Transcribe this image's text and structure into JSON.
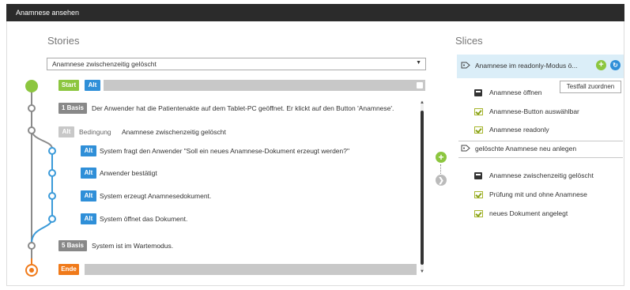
{
  "window": {
    "title": "Anamnese ansehen"
  },
  "stories": {
    "title": "Stories",
    "dropdown": {
      "selected": "Anamnese zwischenzeitig gelöscht"
    },
    "start": {
      "badge": "Start",
      "alt": "Alt"
    },
    "steps": [
      {
        "badge": "1 Basis",
        "text": "Der Anwender hat die Patientenakte auf dem Tablet-PC geöffnet. Er klickt auf den Button 'Anamnese'."
      },
      {
        "badge": "Alt",
        "label": "Bedingung",
        "text": "Anamnese zwischenzeitig gelöscht"
      },
      {
        "badge": "Alt",
        "text": "System fragt den Anwender \"Soll ein neues Anamnese-Dokument erzeugt werden?\""
      },
      {
        "badge": "Alt",
        "text": "Anwender bestätigt"
      },
      {
        "badge": "Alt",
        "text": "System erzeugt Anamnesedokument."
      },
      {
        "badge": "Alt",
        "text": "System öffnet das Dokument."
      },
      {
        "badge": "5 Basis",
        "text": "System ist im Wartemodus."
      }
    ],
    "end": {
      "badge": "Ende"
    }
  },
  "slices": {
    "title": "Slices",
    "groups": [
      {
        "label": "Anamnese im readonly-Modus ö...",
        "items": [
          {
            "icon": "document-icon",
            "label": "Anamnese öffnen"
          },
          {
            "icon": "checkbox-icon",
            "label": "Anamnese-Button auswählbar"
          },
          {
            "icon": "checkbox-icon",
            "label": "Anamnese readonly"
          }
        ]
      },
      {
        "label": "gelöschte Anamnese neu anlegen",
        "items": [
          {
            "icon": "document-icon",
            "label": "Anamnese zwischenzeitig gelöscht"
          },
          {
            "icon": "checkbox-icon",
            "label": "Prüfung mit und ohne Anamnese"
          },
          {
            "icon": "checkbox-icon",
            "label": "neues Dokument angelegt"
          }
        ]
      }
    ],
    "tooltip": "Testfall zuordnen"
  },
  "colors": {
    "basis": "#888888",
    "alt": "#2f8fd8",
    "start": "#8cc63f",
    "end": "#f07a1a",
    "branch": "#3a9ad9"
  }
}
